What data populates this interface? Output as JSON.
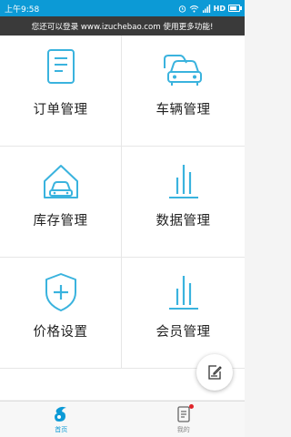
{
  "status_bar": {
    "time": "上午9:58",
    "network": "HD"
  },
  "notice": {
    "text": "您还可以登录 www.izuchebao.com 使用更多功能!"
  },
  "menu": {
    "items": [
      {
        "label": "订单管理",
        "icon": "order-document-icon"
      },
      {
        "label": "车辆管理",
        "icon": "vehicles-icon"
      },
      {
        "label": "库存管理",
        "icon": "garage-car-icon"
      },
      {
        "label": "数据管理",
        "icon": "bar-chart-icon"
      },
      {
        "label": "价格设置",
        "icon": "shield-plus-icon"
      },
      {
        "label": "会员管理",
        "icon": "bar-chart-icon"
      }
    ]
  },
  "bottom_nav": {
    "home_label": "首页",
    "mine_label": "我的"
  },
  "colors": {
    "accent": "#0c9ad6",
    "icon": "#3ab3de",
    "notice_bg": "#3a3a3a",
    "badge": "#e0242a"
  }
}
